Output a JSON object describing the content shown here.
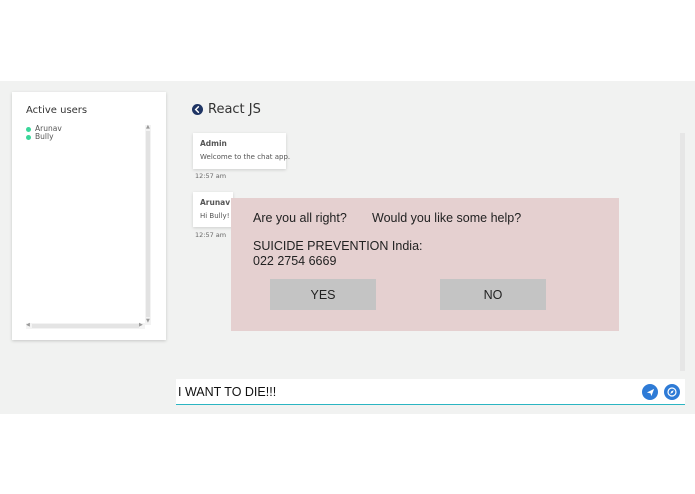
{
  "sidebar": {
    "title": "Active users",
    "users": [
      {
        "name": "Arunav",
        "status_color": "#3ad69a"
      },
      {
        "name": "Bully",
        "status_color": "#3ad69a"
      }
    ]
  },
  "chat": {
    "title": "React JS",
    "messages": [
      {
        "author": "Admin",
        "text": "Welcome to the chat app.",
        "time": "12:57 am"
      },
      {
        "author": "Arunav",
        "text": "Hi Bully!",
        "time": "12:57 am"
      }
    ]
  },
  "popup": {
    "question1": "Are you all right?",
    "question2": "Would you like some help?",
    "helpline_line1": "SUICIDE PREVENTION India:",
    "helpline_line2": "022 2754 6669",
    "yes_label": "YES",
    "no_label": "NO",
    "background": "#e5d0d0"
  },
  "composer": {
    "value": "I WANT TO DIE!!!",
    "send_icon": "send-icon",
    "emoji_icon": "compass-icon",
    "accent": "#2e7bd6"
  }
}
